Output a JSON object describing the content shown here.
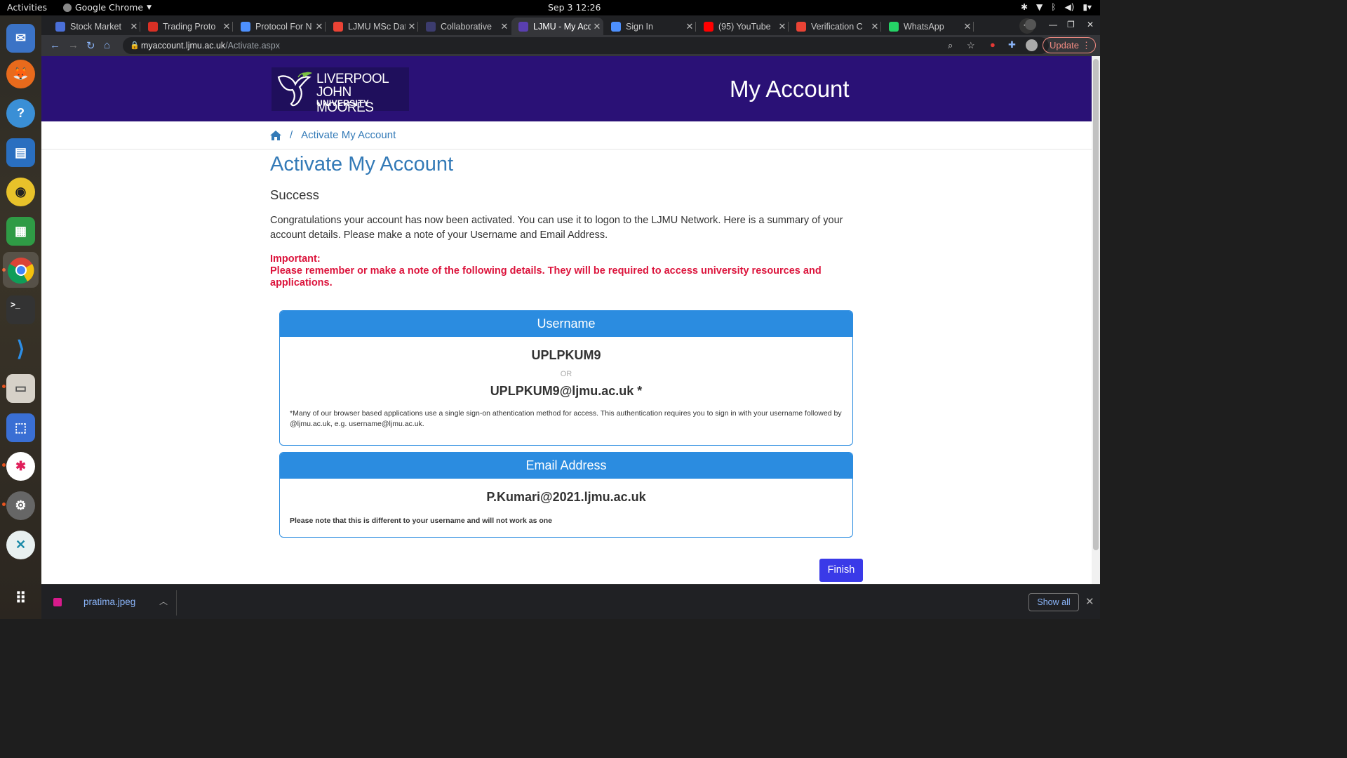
{
  "topbar": {
    "activities": "Activities",
    "app_name": "Google Chrome",
    "clock": "Sep 3  12:26"
  },
  "dock": {
    "items": [
      "thunderbird-icon",
      "firefox-icon",
      "help-icon",
      "writer-icon",
      "rhythmbox-icon",
      "calc-icon",
      "chrome-icon",
      "terminal-icon",
      "vscode-icon",
      "files-icon",
      "screenshot-icon",
      "slack-icon",
      "settings-icon",
      "remote-icon",
      "app-grid-icon"
    ]
  },
  "tabs": [
    {
      "title": "Stock Market",
      "color": "#4a6fd8"
    },
    {
      "title": "Trading Proto",
      "color": "#d93025"
    },
    {
      "title": "Protocol For N",
      "color": "#4d90fe"
    },
    {
      "title": "LJMU MSc Dat",
      "color": "#ea4335"
    },
    {
      "title": "Collaborative",
      "color": "#3c3c6e"
    },
    {
      "title": "LJMU - My Acc",
      "color": "#5a3fb0"
    },
    {
      "title": "Sign In",
      "color": "#4d90fe"
    },
    {
      "title": "(95) YouTube",
      "color": "#ff0000"
    },
    {
      "title": "Verification C",
      "color": "#ea4335"
    },
    {
      "title": "WhatsApp",
      "color": "#25d366"
    }
  ],
  "omnibox": {
    "host": "myaccount.ljmu.ac.uk",
    "path": "/Activate.aspx",
    "update_label": "Update"
  },
  "header": {
    "logo_line1": "LIVERPOOL",
    "logo_line2": "JOHN MOORES",
    "logo_line3": "UNIVERSITY",
    "title": "My Account"
  },
  "breadcrumb": {
    "separator": "/",
    "current": "Activate My Account"
  },
  "main": {
    "title": "Activate My Account",
    "status": "Success",
    "intro": "Congratulations your account has now been activated. You can use it to logon to the LJMU Network. Here is a summary of your account details. Please make a note of your Username and Email Address.",
    "important_label": "Important:",
    "important_text": "Please remember or make a note of the following details. They will be required to access university resources and applications."
  },
  "username_panel": {
    "heading": "Username",
    "username": "UPLPKUM9",
    "or": "OR",
    "alt_username": "UPLPKUM9@ljmu.ac.uk *",
    "note": "*Many of our browser based applications use a single sign-on athentication method for access. This authentication requires you to sign in with your username followed by @ljmu.ac.uk, e.g. username@ljmu.ac.uk."
  },
  "email_panel": {
    "heading": "Email Address",
    "email": "P.Kumari@2021.ljmu.ac.uk",
    "note": "Please note that this is different to your username and will not work as one"
  },
  "finish_label": "Finish",
  "download_bar": {
    "file_name": "pratima.jpeg",
    "show_all": "Show all"
  }
}
